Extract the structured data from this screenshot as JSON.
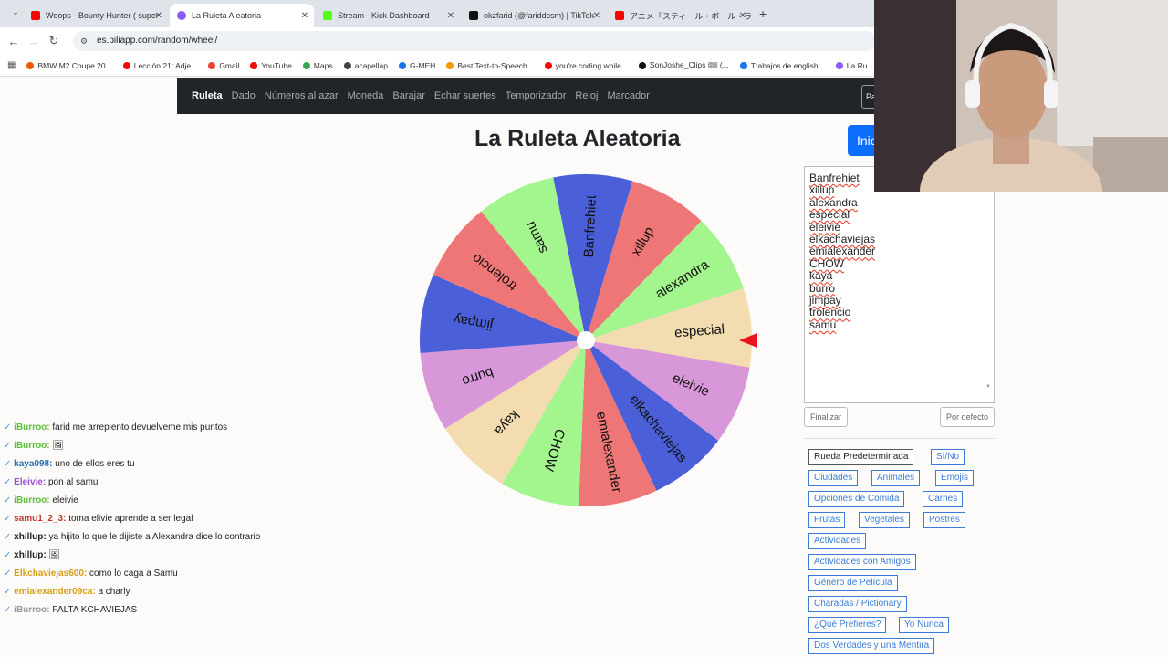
{
  "tabs": [
    {
      "label": "Woops - Bounty Hunter ( super",
      "color": "#ff0000"
    },
    {
      "label": "La Ruleta Aleatoria",
      "color": "#8b5cf6"
    },
    {
      "label": "Stream - Kick Dashboard",
      "color": "#53fc18"
    },
    {
      "label": "okzfarid (@fariddcsm) | TikTok",
      "color": "#111111"
    },
    {
      "label": "アニメ『スティール・ボール・ラン ジョジ",
      "color": "#ff0000"
    }
  ],
  "url": "es.piliapp.com/random/wheel/",
  "bookmarks": [
    {
      "label": "BMW M2 Coupe 20...",
      "color": "#e65c00"
    },
    {
      "label": "Lección 21: Adje...",
      "color": "#ff0000"
    },
    {
      "label": "Gmail",
      "color": "#ea4335"
    },
    {
      "label": "YouTube",
      "color": "#ff0000"
    },
    {
      "label": "Maps",
      "color": "#34a853"
    },
    {
      "label": "acapellap",
      "color": "#444444"
    },
    {
      "label": "G-MEH",
      "color": "#1a73e8"
    },
    {
      "label": "Best Text-to-Speech...",
      "color": "#f29900"
    },
    {
      "label": "you're coding while...",
      "color": "#ff0000"
    },
    {
      "label": "SonJoshe_Clips 🎟 (...",
      "color": "#111111"
    },
    {
      "label": "Trabajos de english...",
      "color": "#1a73e8"
    },
    {
      "label": "La Ru",
      "color": "#8b5cf6"
    }
  ],
  "site_nav": [
    "Ruleta",
    "Dado",
    "Números al azar",
    "Moneda",
    "Barajar",
    "Echar suertes",
    "Temporizador",
    "Reloj",
    "Marcador"
  ],
  "site_nav_field": "Pa",
  "page_title": "La Ruleta Aleatoria",
  "start_button": "Inic",
  "wheel": {
    "segments": [
      {
        "label": "Banfrehiet",
        "color": "#4a5fd8"
      },
      {
        "label": "xillup",
        "color": "#ee7676"
      },
      {
        "label": "alexandra",
        "color": "#a3f58d"
      },
      {
        "label": "especial",
        "color": "#f2dcb0"
      },
      {
        "label": "eleivie",
        "color": "#d897d8"
      },
      {
        "label": "elkachaviejas",
        "color": "#4a5fd8"
      },
      {
        "label": "emialexander",
        "color": "#ee7676"
      },
      {
        "label": "CHOW",
        "color": "#a3f58d"
      },
      {
        "label": "kaya",
        "color": "#f2dcb0"
      },
      {
        "label": "burro",
        "color": "#d897d8"
      },
      {
        "label": "jimpay",
        "color": "#4a5fd8"
      },
      {
        "label": "trolencio",
        "color": "#ee7676"
      },
      {
        "label": "samu",
        "color": "#a3f58d"
      }
    ],
    "pointer_color": "#e8141f"
  },
  "names_list": [
    "Banfrehiet",
    "xillup",
    "alexandra",
    "especial",
    "eleivie",
    "elkachaviejas",
    "emialexander",
    "CHOW",
    "kaya",
    "burro",
    "jimpay",
    "trolencio",
    "samu"
  ],
  "buttons": {
    "finish": "Finalizar",
    "default": "Por defecto"
  },
  "presets": [
    "Rueda Predeterminada",
    "Sí/No",
    "Ciudades",
    "Animales",
    "Emojis",
    "Opciones de Comida",
    "Carnes",
    "Frutas",
    "Vegetales",
    "Postres",
    "Actividades",
    "Actividades con Amigos",
    "Género de Película",
    "Charadas / Pictionary",
    "¿Qué Prefieres?",
    "Yo Nunca",
    "Dos Verdades y una Mentira"
  ],
  "chat": [
    {
      "user": "iBurroo:",
      "color": "#5bc236",
      "text": "farid me arrepiento devuelveme mis puntos"
    },
    {
      "user": "iBurroo:",
      "color": "#5bc236",
      "text": "🖼"
    },
    {
      "user": "kaya098:",
      "color": "#1e6fb8",
      "text": "uno de ellos eres tu"
    },
    {
      "user": "Eleivie:",
      "color": "#9b4fd0",
      "text": "pon al samu"
    },
    {
      "user": "iBurroo:",
      "color": "#5bc236",
      "text": "eleivie"
    },
    {
      "user": "samu1_2_3:",
      "color": "#c0392b",
      "text": "toma elivie aprende a ser legal"
    },
    {
      "user": "xhillup:",
      "color": "#222222",
      "text": "ya hijito lo que le dijiste a Alexandra dice lo contrario"
    },
    {
      "user": "xhillup:",
      "color": "#222222",
      "text": "🖼"
    },
    {
      "user": "Elkchaviejas600:",
      "color": "#d4a017",
      "text": "como lo caga a Samu"
    },
    {
      "user": "emialexander09ca:",
      "color": "#d4a017",
      "text": "a charly"
    },
    {
      "user": "iBurroo:",
      "color": "#999999",
      "text": "FALTA KCHAVIEJAS"
    }
  ]
}
